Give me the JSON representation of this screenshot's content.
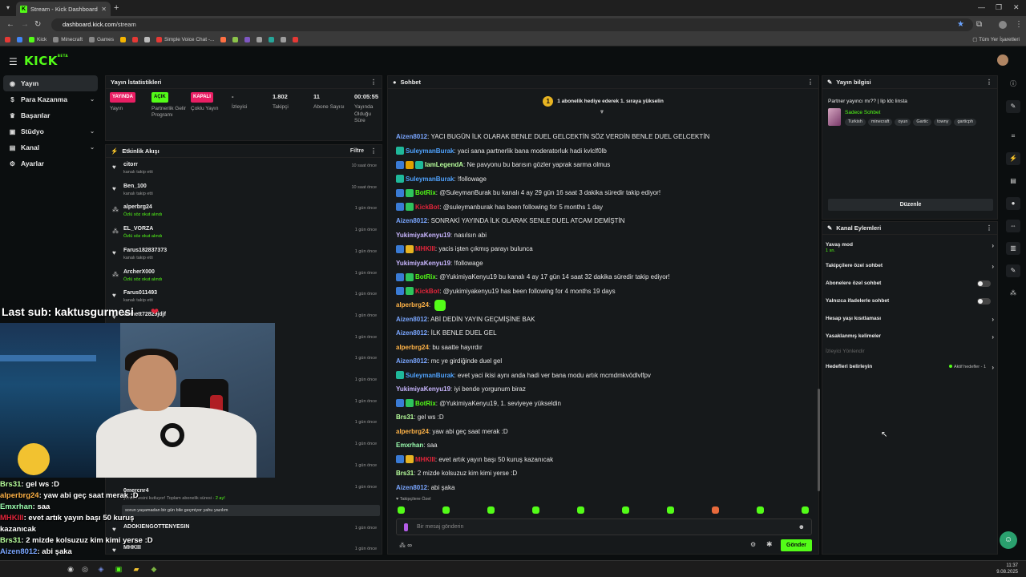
{
  "browser": {
    "tab_title": "Stream - Kick Dashboard",
    "tab_favicon": "K",
    "url_host": "dashboard.kick.com",
    "url_path": "/stream",
    "bookmarks": [
      {
        "label": "",
        "color": "#e53935"
      },
      {
        "label": "",
        "color": "#4285f4"
      },
      {
        "label": "Kick",
        "color": "#53fc18"
      },
      {
        "label": "Minecraft",
        "color": "#888888"
      },
      {
        "label": "Games",
        "color": "#888888"
      },
      {
        "label": "",
        "color": "#f4b400"
      },
      {
        "label": "",
        "color": "#e53935"
      },
      {
        "label": "",
        "color": "#bbbbbb"
      },
      {
        "label": "Simple Voice Chat -...",
        "color": "#e53935"
      },
      {
        "label": "",
        "color": "#ff7043"
      },
      {
        "label": "",
        "color": "#8bc34a"
      },
      {
        "label": "",
        "color": "#7e57c2"
      },
      {
        "label": "",
        "color": "#9e9e9e"
      },
      {
        "label": "",
        "color": "#26a69a"
      },
      {
        "label": "",
        "color": "#9e9e9e"
      },
      {
        "label": "",
        "color": "#e53935"
      }
    ],
    "all_bookmarks": "Tüm Yer İşaretleri"
  },
  "sidebar": {
    "items": [
      {
        "label": "Yayın",
        "icon": "broadcast-icon",
        "active": true
      },
      {
        "label": "Para Kazanma",
        "icon": "dollar-icon",
        "chevron": true
      },
      {
        "label": "Başarılar",
        "icon": "trophy-icon"
      },
      {
        "label": "Stüdyo",
        "icon": "studio-icon",
        "chevron": true
      },
      {
        "label": "Kanal",
        "icon": "channel-icon",
        "chevron": true
      },
      {
        "label": "Ayarlar",
        "icon": "gear-icon"
      }
    ]
  },
  "stats": {
    "title": "Yayın İstatistikleri",
    "cols": [
      {
        "badge": "YAYINDA",
        "badge_bg": "#e91e63",
        "badge_fg": "#ffffff",
        "label": "Yayın"
      },
      {
        "badge": "AÇIK",
        "badge_bg": "#53fc18",
        "badge_fg": "#0b0e0f",
        "label": "Partnerlik Gelir Programı"
      },
      {
        "badge": "KAPALI",
        "badge_bg": "#e91e63",
        "badge_fg": "#ffffff",
        "label": "Çoklu Yayın"
      },
      {
        "value": "-",
        "label": "İzleyici"
      },
      {
        "value": "1.802",
        "label": "Takipçi"
      },
      {
        "value": "11",
        "label": "Abone Sayısı"
      },
      {
        "value": "00:05:55",
        "label": "Yayında Olduğu Süre"
      }
    ]
  },
  "activity": {
    "title": "Etkinlik Akışı",
    "filter": "Filtre",
    "items": [
      {
        "icon": "heart-icon",
        "name": "citorr",
        "sub": "kanalı takip etti",
        "time": "10 saat önce",
        "green": false
      },
      {
        "icon": "heart-icon",
        "name": "Ben_100",
        "sub": "kanalı takip etti",
        "time": "10 saat önce",
        "green": false
      },
      {
        "icon": "points-icon",
        "name": "alperbrg24",
        "sub": "Özlü söz okut alındı",
        "time": "1 gün önce",
        "green": true
      },
      {
        "icon": "points-icon",
        "name": "EL_VORZA",
        "sub": "Özlü söz okut alındı",
        "time": "1 gün önce",
        "green": true
      },
      {
        "icon": "heart-icon",
        "name": "Farus182837373",
        "sub": "kanalı takip etti",
        "time": "1 gün önce",
        "green": false
      },
      {
        "icon": "points-icon",
        "name": "ArcherX000",
        "sub": "Özlü söz okut alındı",
        "time": "1 gün önce",
        "green": true
      },
      {
        "icon": "heart-icon",
        "name": "Farus011493",
        "sub": "kanalı takip etti",
        "time": "1 gün önce",
        "green": false
      },
      {
        "icon": "heart-icon",
        "name": "ahmett72829jdjf",
        "sub": "",
        "time": "1 gün önce",
        "green": false
      },
      {
        "icon": "",
        "name": "",
        "sub": "",
        "time": "1 gün önce",
        "green": false
      },
      {
        "icon": "",
        "name": "",
        "sub": "",
        "time": "1 gün önce",
        "green": false
      },
      {
        "icon": "",
        "name": "",
        "sub": "",
        "time": "1 gün önce",
        "green": false
      },
      {
        "icon": "",
        "name": "",
        "sub": "",
        "time": "1 gün önce",
        "green": false
      },
      {
        "icon": "",
        "name": "",
        "sub": "",
        "time": "1 gün önce",
        "green": false
      },
      {
        "icon": "",
        "name": "",
        "sub": "",
        "time": "1 gün önce",
        "green": false
      },
      {
        "icon": "",
        "name": "",
        "sub": "",
        "time": "1 gün önce",
        "green": false
      },
      {
        "icon": "",
        "name": "",
        "sub": "",
        "time": "1 gün önce",
        "green": false
      }
    ],
    "resub": {
      "name": "0mercnr4",
      "sub": "yenilemesini kutluyor! Toplam abonelik süresi -",
      "months": "2 ay!",
      "message": "sorun yaşamadan bir gün bile geçmiyor yahu yazılım"
    },
    "tail": [
      {
        "icon": "heart-icon",
        "name": "ADOKIENGOTTENYESIN",
        "sub": "",
        "time": "1 gün önce"
      },
      {
        "icon": "heart-icon",
        "name": "MHKIII",
        "sub": "",
        "time": "1 gün önce"
      }
    ]
  },
  "chat": {
    "title": "Sohbet",
    "pinned": "1 abonelik hediye ederek 1. sıraya yükselin",
    "pinned_icon": "1",
    "messages": [
      {
        "user": "Aizen8012",
        "color": "#7aa6ff",
        "badges": [],
        "text": "YACI BUGÜN İLK OLARAK BENLE DUEL GELCEKTİN SÖZ VERDİN BENLE DUEL GELCEKTİN"
      },
      {
        "user": "SuleymanBurak",
        "color": "#4fa3ff",
        "badges": [
          "#1fb89a"
        ],
        "text": "yaci sana partnerlik bana moderatorluk hadi kvlclf0lb"
      },
      {
        "user": "IamLegendA",
        "color": "#b8ff9c",
        "badges": [
          "#3a7bd5",
          "#e0a000",
          "#1fb89a"
        ],
        "text": "Ne pavyonu bu barısın gözler yaprak sarma olmus"
      },
      {
        "user": "SuleymanBurak",
        "color": "#4fa3ff",
        "badges": [
          "#1fb89a"
        ],
        "text": "!followage"
      },
      {
        "user": "BotRix",
        "color": "#53fc18",
        "badges": [
          "#3a7bd5",
          "#2ec45c"
        ],
        "text": "@SuleymanBurak bu kanalı 4 ay 29 gün 16 saat 3 dakika süredir takip ediyor!"
      },
      {
        "user": "KickBot",
        "color": "#e0253a",
        "badges": [
          "#3a7bd5",
          "#2ec45c"
        ],
        "text": "@suleymanburak has been following for 5 months 1 day"
      },
      {
        "user": "Aizen8012",
        "color": "#7aa6ff",
        "badges": [],
        "text": "SONRAKİ YAYINDA İLK OLARAK SENLE DUEL ATCAM DEMİŞTİN"
      },
      {
        "user": "YukimiyaKenyu19",
        "color": "#c9b6ff",
        "badges": [],
        "text": "nasılsın abi"
      },
      {
        "user": "MHKIII",
        "color": "#e0253a",
        "badges": [
          "#3a7bd5",
          "#e8b422"
        ],
        "text": "yacis işten çıkmış parayı bulunca"
      },
      {
        "user": "YukimiyaKenyu19",
        "color": "#c9b6ff",
        "badges": [],
        "text": "!followage"
      },
      {
        "user": "BotRix",
        "color": "#53fc18",
        "badges": [
          "#3a7bd5",
          "#2ec45c"
        ],
        "text": "@YukimiyaKenyu19 bu kanalı 4 ay 17 gün 14 saat 32 dakika süredir takip ediyor!"
      },
      {
        "user": "KickBot",
        "color": "#e0253a",
        "badges": [
          "#3a7bd5",
          "#2ec45c"
        ],
        "text": "@yukimiyakenyu19 has been following for 4 months 19 days"
      },
      {
        "user": "alperbrg24",
        "color": "#ffb347",
        "badges": [],
        "text": "",
        "emote": true
      },
      {
        "user": "Aizen8012",
        "color": "#7aa6ff",
        "badges": [],
        "text": "ABİ DEDİN YAYIN GEÇMİŞİNE BAK"
      },
      {
        "user": "Aizen8012",
        "color": "#7aa6ff",
        "badges": [],
        "text": "İLK BENLE DUEL GEL"
      },
      {
        "user": "alperbrg24",
        "color": "#ffb347",
        "badges": [],
        "text": "bu saatte hayırdır"
      },
      {
        "user": "Aizen8012",
        "color": "#7aa6ff",
        "badges": [],
        "text": "mc ye girdiğinde duel gel"
      },
      {
        "user": "SuleymanBurak",
        "color": "#4fa3ff",
        "badges": [
          "#1fb89a"
        ],
        "text": "evet yaci ikisi aynı anda hadi ver bana modu artık mcmdmkvödlvlfpv"
      },
      {
        "user": "YukimiyaKenyu19",
        "color": "#c9b6ff",
        "badges": [],
        "text": "iyi bende yorgunum biraz"
      },
      {
        "user": "BotRix",
        "color": "#53fc18",
        "badges": [
          "#3a7bd5",
          "#2ec45c"
        ],
        "text": "@YukimiyaKenyu19, 1. seviyeye yükseldin"
      },
      {
        "user": "Brs31",
        "color": "#b8ff9c",
        "badges": [],
        "text": "gel ws :D"
      },
      {
        "user": "alperbrg24",
        "color": "#ffb347",
        "badges": [],
        "text": "yaw abi geç saat merak :D"
      },
      {
        "user": "Emxrhan",
        "color": "#9cffb0",
        "badges": [],
        "text": "saa"
      },
      {
        "user": "MHKIII",
        "color": "#e0253a",
        "badges": [
          "#3a7bd5",
          "#e8b422"
        ],
        "text": "evet artık yayın başı 50 kuruş kazanıcak"
      },
      {
        "user": "Brs31",
        "color": "#b8ff9c",
        "badges": [],
        "text": "2 mizde kolsuzuz kim kimi yerse :D"
      },
      {
        "user": "Aizen8012",
        "color": "#7aa6ff",
        "badges": [],
        "text": "abi şaka"
      }
    ],
    "follower_only": "♥ Takipçilere Özel",
    "input_placeholder": "Bir mesaj gönderin",
    "points": "∞",
    "send_label": "Gönder"
  },
  "stream_info": {
    "title": "Yayın bilgisi",
    "stream_title": "Partner yayıncı mı?? | lip ldc linsta",
    "category": "Sadece Sohbet",
    "tags": [
      "Turkish",
      "minecraft",
      "oyun",
      "Gartic",
      "towny",
      "garticph"
    ],
    "edit_label": "Düzenle"
  },
  "channel_actions": {
    "title": "Kanal Eylemleri",
    "rows": [
      {
        "label": "Yavaş mod",
        "sub": "1 sn.",
        "type": "chevron"
      },
      {
        "label": "Takipçilere özel sohbet",
        "type": "chevron"
      },
      {
        "label": "Abonelere özel sohbet",
        "type": "toggle"
      },
      {
        "label": "Yalnızca ifadelerle sohbet",
        "type": "toggle"
      },
      {
        "label": "Hesap yaşı kısıtlaması",
        "type": "chevron"
      },
      {
        "label": "Yasaklanmış kelimeler",
        "type": "chevron"
      },
      {
        "label": "İzleyici Yönlendir",
        "type": "dim"
      },
      {
        "label": "Hedefleri belirleyin",
        "type": "goal",
        "extra": "Aktif hedefler - 1"
      }
    ]
  },
  "overlay": {
    "last_sub": "Last sub: kaktusgurmesi",
    "chat": [
      {
        "user": "Brs31",
        "color": "#b8ff9c",
        "text": "gel ws :D"
      },
      {
        "user": "alperbrg24",
        "color": "#ffb347",
        "text": "yaw abi geç saat merak :D"
      },
      {
        "user": "Emxrhan",
        "color": "#9cffb0",
        "text": "saa"
      },
      {
        "user": "MHKIII",
        "color": "#e0253a",
        "text": "evet artık yayın başı 50 kuruş",
        "text2": "kazanıcak"
      },
      {
        "user": "Brs31",
        "color": "#b8ff9c",
        "text": "2 mizde kolsuzuz kim kimi yerse :D"
      },
      {
        "user": "Aizen8012",
        "color": "#7aa6ff",
        "text": "abi şaka"
      }
    ]
  },
  "taskbar": {
    "time": "11:37",
    "date": "9.08.2025"
  },
  "colors": {
    "accent": "#53fc18",
    "live": "#e91e63",
    "bg": "#0b0e0f",
    "panel": "#16191b"
  }
}
